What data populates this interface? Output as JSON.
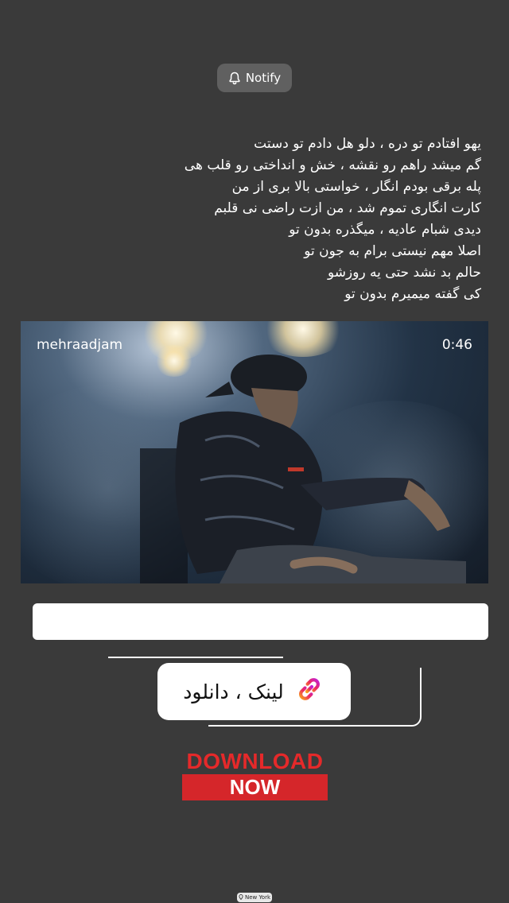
{
  "notify": {
    "icon": "bell-icon",
    "label": "Notify"
  },
  "lyrics": [
    "یهو افتادم تو دره ، دلو هل دادم تو دستت",
    "گم میشد راهم رو نقشه ، خش و انداختی رو قلب هی",
    "پله برقی بودم انگار ، خواستی بالا بری از من",
    "کارت انگاری تموم شد ، من ازت راضی نی قلبم",
    "دیدی شبام عادیه ، میگذره بدون تو",
    "اصلا مهم نیستی برام به جون تو",
    "حالم بد نشد حتی یه روزشو",
    "کی گفته میمیرم بدون تو"
  ],
  "video": {
    "author": "mehraadjam",
    "duration": "0:46"
  },
  "link_sticker": {
    "icon": "link-icon",
    "label": "لینک ، دانلود"
  },
  "download": {
    "line1": "DOWNLOAD",
    "line2": "NOW"
  },
  "location": {
    "icon": "location-pin-icon",
    "label": "New York"
  },
  "colors": {
    "background": "#3a3a3a",
    "download_red": "#e5292a",
    "link_gradient_start": "#f7a21b",
    "link_gradient_end": "#c21fd6"
  }
}
